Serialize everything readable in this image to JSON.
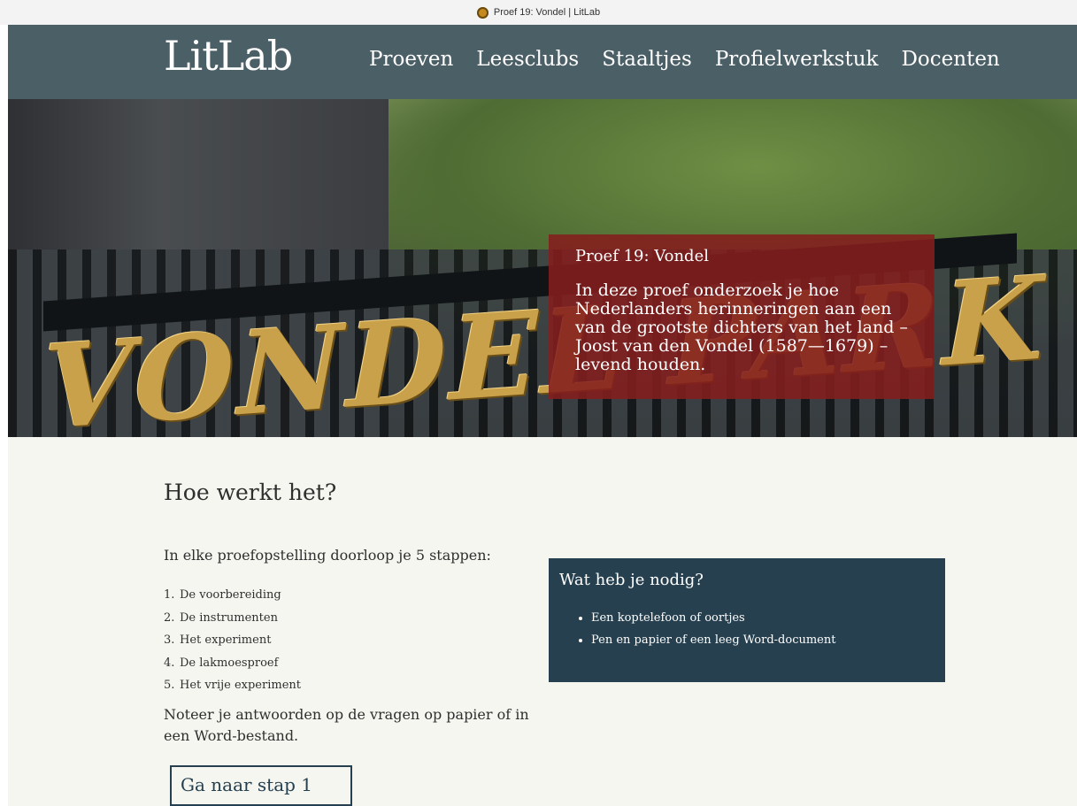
{
  "browser": {
    "tab_title": "Proef 19: Vondel | LitLab",
    "favicon": "sunflower-icon"
  },
  "header": {
    "logo": "LitLab",
    "nav": [
      "Proeven",
      "Leesclubs",
      "Staaltjes",
      "Profielwerkstuk",
      "Docenten"
    ]
  },
  "hero": {
    "image_text": "VONDEL PARK",
    "kicker": "Proef 19: Vondel",
    "lead": "In deze proef onderzoek je hoe Nederlanders herinneringen aan een van de grootste dichters van het land – Joost van den Vondel (1587—1679) – levend houden."
  },
  "main": {
    "heading": "Hoe werkt het?",
    "intro": "In elke proefopstelling doorloop je 5 stappen:",
    "steps": [
      {
        "num": "1.",
        "label": "De voorbereiding"
      },
      {
        "num": "2.",
        "label": "De instrumenten"
      },
      {
        "num": "3.",
        "label": "Het experiment"
      },
      {
        "num": "4.",
        "label": "De lakmoesproef"
      },
      {
        "num": "5.",
        "label": "Het vrije experiment"
      }
    ],
    "note": "Noteer je antwoorden op de vragen op papier of in een Word-bestand.",
    "cta": "Ga naar stap 1"
  },
  "needs": {
    "title": "Wat heb je nodig?",
    "items": [
      "Een koptelefoon of oortjes",
      "Pen en papier of een leeg Word-document"
    ]
  },
  "colors": {
    "nav_bg": "#4b5f67",
    "hero_card_bg": "#841e1e",
    "needs_bg": "#26404f",
    "page_bg": "#f6f6f0"
  }
}
